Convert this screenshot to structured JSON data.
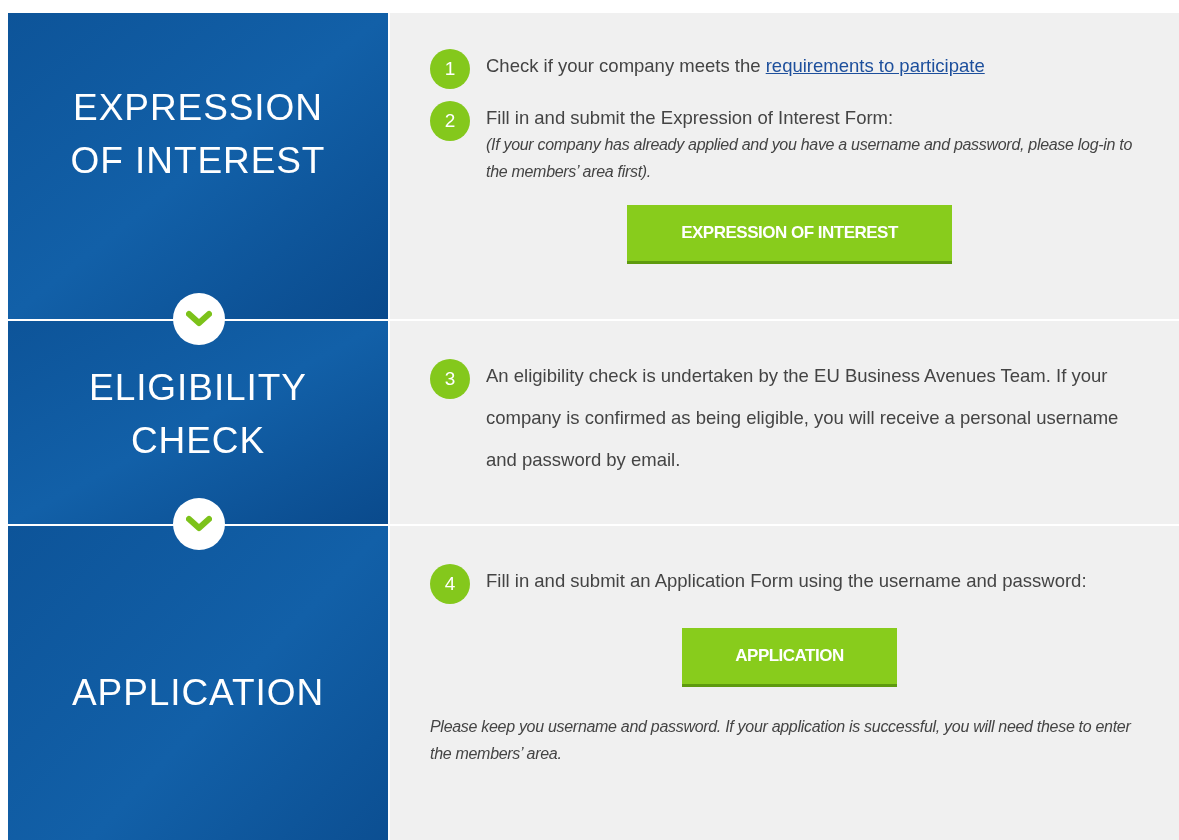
{
  "sections": [
    {
      "title": "EXPRESSION OF INTEREST",
      "steps": [
        {
          "number": "1",
          "text": "Check if your company meets the",
          "link": "requirements to participate"
        },
        {
          "number": "2",
          "text": "Fill in and submit the Expression of Interest Form:",
          "note": "(If your company has already applied and you have a username and password, please log-in to the members’ area first)."
        }
      ],
      "button": "EXPRESSION OF INTEREST"
    },
    {
      "title": "ELIGIBILITY CHECK",
      "steps": [
        {
          "number": "3",
          "text": "An eligibility check is undertaken by the EU Business Avenues Team. If your company is confirmed as being eligible, you will receive a personal username and password by email."
        }
      ]
    },
    {
      "title": "APPLICATION",
      "steps": [
        {
          "number": "4",
          "text": "Fill in and submit an Application Form using the username and password:"
        }
      ],
      "button": "APPLICATION",
      "footnote": "Please keep you username and password. If your application is successful, you will need these to enter the members’ area."
    }
  ]
}
